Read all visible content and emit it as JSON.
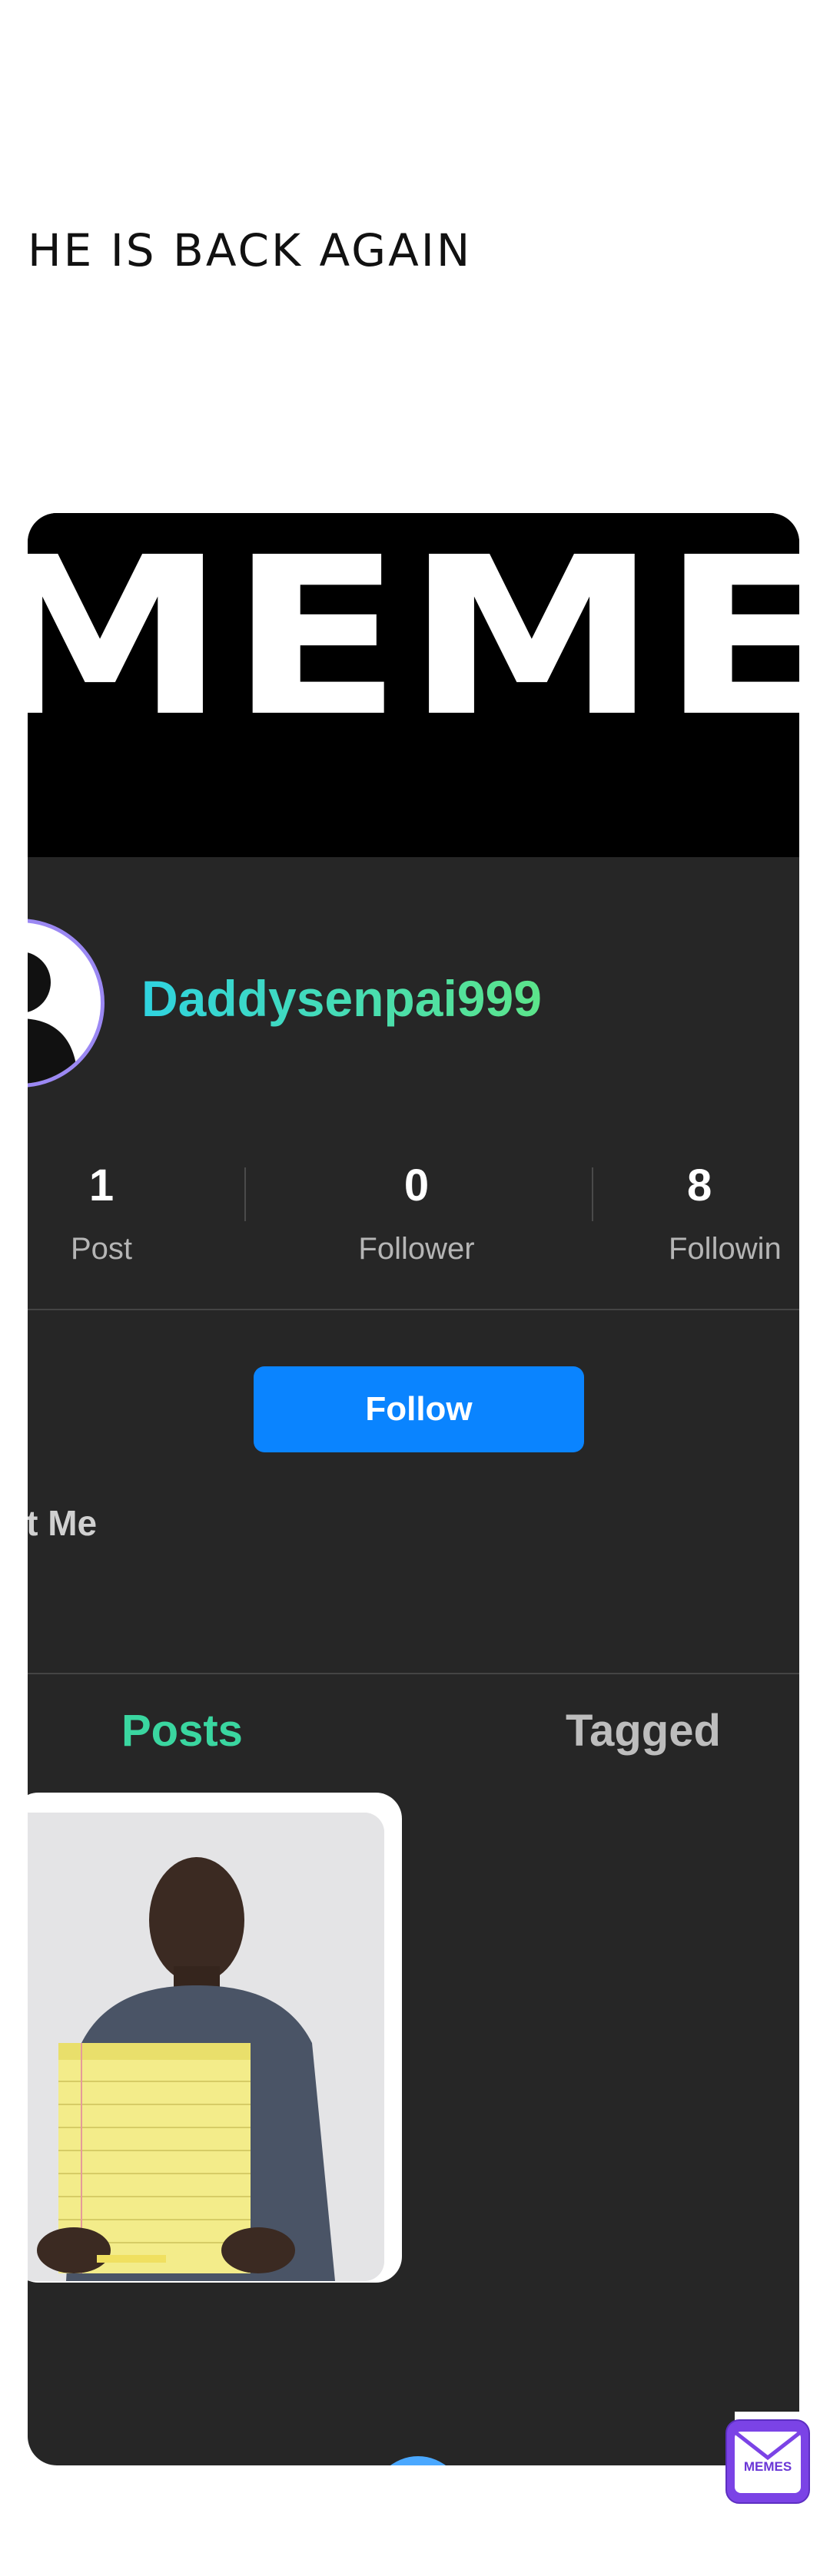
{
  "caption": "HE IS BACK AGAIN",
  "banner": {
    "text": "MEMES"
  },
  "profile": {
    "username": "Daddysenpai999",
    "stats": [
      {
        "value": "1",
        "label": "Post"
      },
      {
        "value": "0",
        "label": "Follower"
      },
      {
        "value": "8",
        "label": "Followin"
      }
    ],
    "follow_label": "Follow",
    "about_label": "ut Me"
  },
  "tabs": [
    {
      "label": "Posts",
      "active": true
    },
    {
      "label": "Tagged",
      "active": false
    }
  ],
  "colors": {
    "card_bg": "#262626",
    "follow_button": "#0a84ff",
    "username_gradient": [
      "#2fd3e0",
      "#5ce58a"
    ],
    "active_tab": "#3ad6a0",
    "logo": "#7b43e6"
  },
  "watermark": {
    "text": "MEMES"
  }
}
